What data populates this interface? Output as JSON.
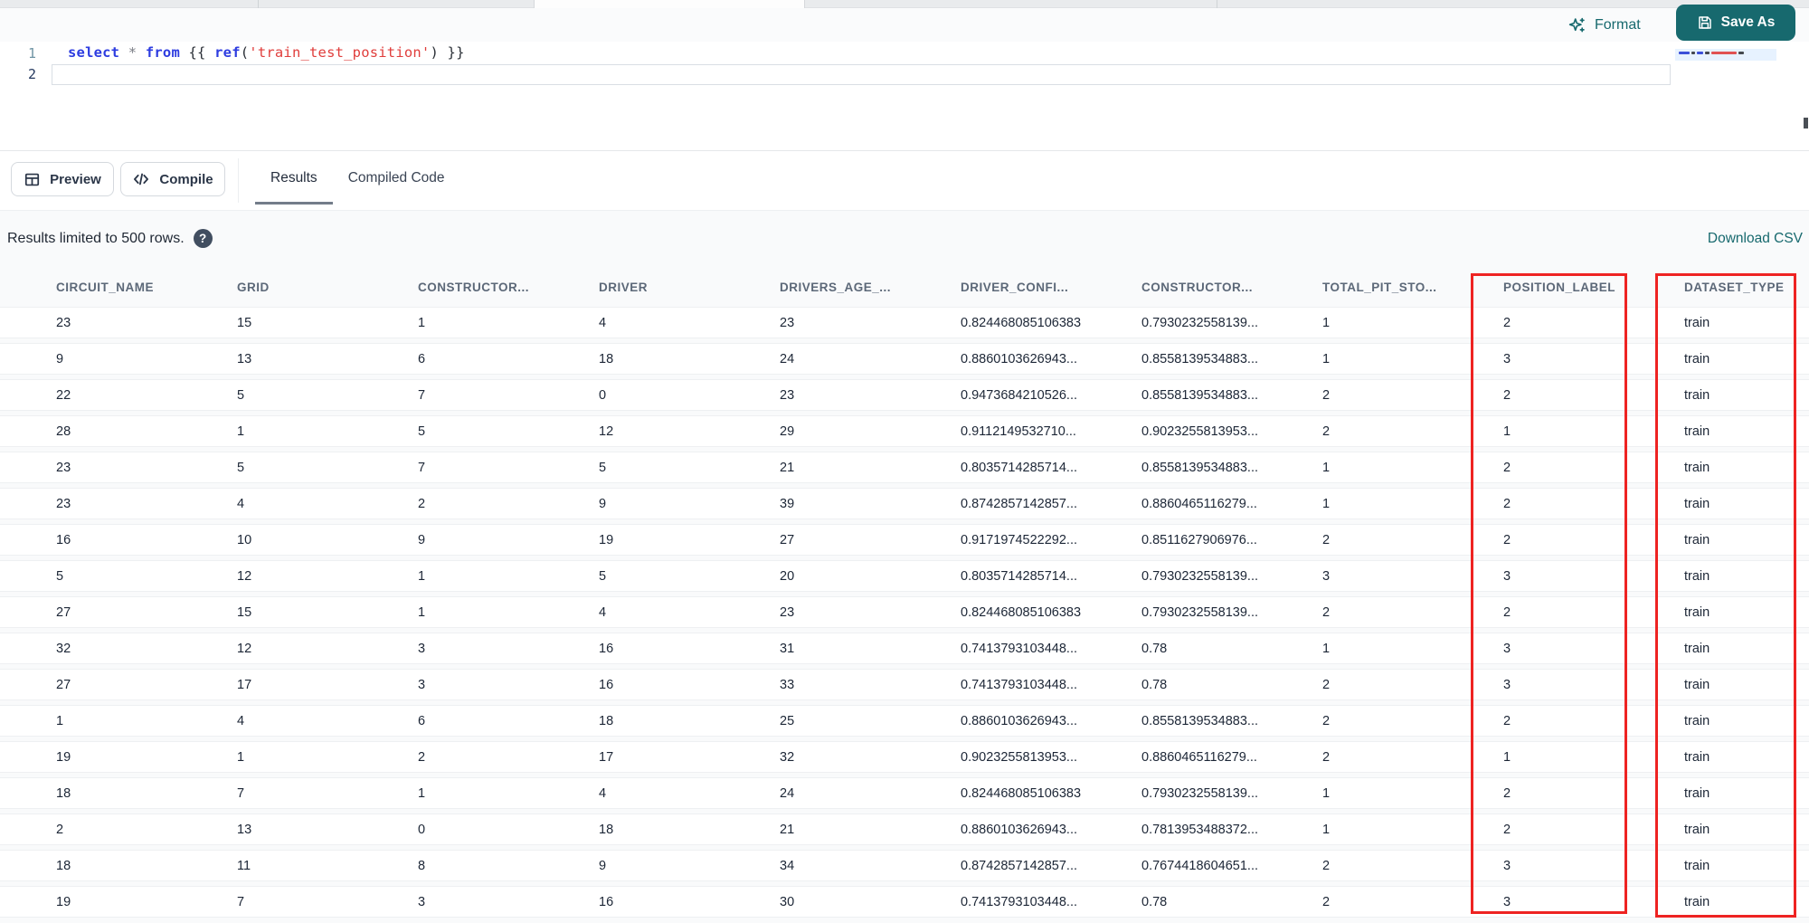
{
  "colors": {
    "accent_teal": "#17696e",
    "highlight_red": "#ee2322",
    "keyword_blue": "#2d3ce0",
    "string_red": "#e03e3c"
  },
  "top_bar": {
    "format_label": "Format",
    "save_as_label": "Save As"
  },
  "editor": {
    "line_numbers": [
      "1",
      "2"
    ],
    "code_plain": "select * from {{ ref('train_test_position') }}",
    "code_tokens": [
      {
        "t": "select",
        "c": "kw"
      },
      {
        "t": " ",
        "c": "pl"
      },
      {
        "t": "*",
        "c": "op"
      },
      {
        "t": " ",
        "c": "pl"
      },
      {
        "t": "from",
        "c": "kw"
      },
      {
        "t": " {{ ",
        "c": "pl"
      },
      {
        "t": "ref",
        "c": "kw"
      },
      {
        "t": "(",
        "c": "pl"
      },
      {
        "t": "'train_test_position'",
        "c": "str"
      },
      {
        "t": ")",
        "c": "pl"
      },
      {
        "t": " }}",
        "c": "pl"
      }
    ]
  },
  "action_bar": {
    "preview_label": "Preview",
    "compile_label": "Compile",
    "tabs": [
      {
        "label": "Results",
        "active": true
      },
      {
        "label": "Compiled Code",
        "active": false
      }
    ]
  },
  "results": {
    "limit_notice": "Results limited to 500 rows.",
    "help_icon": "?",
    "download_csv_label": "Download CSV",
    "columns": [
      "CIRCUIT_NAME",
      "GRID",
      "CONSTRUCTOR...",
      "DRIVER",
      "DRIVERS_AGE_...",
      "DRIVER_CONFI...",
      "CONSTRUCTOR...",
      "TOTAL_PIT_STO...",
      "POSITION_LABEL",
      "DATASET_TYPE"
    ],
    "rows": [
      [
        "23",
        "15",
        "1",
        "4",
        "23",
        "0.824468085106383",
        "0.7930232558139...",
        "1",
        "2",
        "train"
      ],
      [
        "9",
        "13",
        "6",
        "18",
        "24",
        "0.8860103626943...",
        "0.8558139534883...",
        "1",
        "3",
        "train"
      ],
      [
        "22",
        "5",
        "7",
        "0",
        "23",
        "0.9473684210526...",
        "0.8558139534883...",
        "2",
        "2",
        "train"
      ],
      [
        "28",
        "1",
        "5",
        "12",
        "29",
        "0.9112149532710...",
        "0.9023255813953...",
        "2",
        "1",
        "train"
      ],
      [
        "23",
        "5",
        "7",
        "5",
        "21",
        "0.8035714285714...",
        "0.8558139534883...",
        "1",
        "2",
        "train"
      ],
      [
        "23",
        "4",
        "2",
        "9",
        "39",
        "0.8742857142857...",
        "0.8860465116279...",
        "1",
        "2",
        "train"
      ],
      [
        "16",
        "10",
        "9",
        "19",
        "27",
        "0.9171974522292...",
        "0.8511627906976...",
        "2",
        "2",
        "train"
      ],
      [
        "5",
        "12",
        "1",
        "5",
        "20",
        "0.8035714285714...",
        "0.7930232558139...",
        "3",
        "3",
        "train"
      ],
      [
        "27",
        "15",
        "1",
        "4",
        "23",
        "0.824468085106383",
        "0.7930232558139...",
        "2",
        "2",
        "train"
      ],
      [
        "32",
        "12",
        "3",
        "16",
        "31",
        "0.7413793103448...",
        "0.78",
        "1",
        "3",
        "train"
      ],
      [
        "27",
        "17",
        "3",
        "16",
        "33",
        "0.7413793103448...",
        "0.78",
        "2",
        "3",
        "train"
      ],
      [
        "1",
        "4",
        "6",
        "18",
        "25",
        "0.8860103626943...",
        "0.8558139534883...",
        "2",
        "2",
        "train"
      ],
      [
        "19",
        "1",
        "2",
        "17",
        "32",
        "0.9023255813953...",
        "0.8860465116279...",
        "2",
        "1",
        "train"
      ],
      [
        "18",
        "7",
        "1",
        "4",
        "24",
        "0.824468085106383",
        "0.7930232558139...",
        "1",
        "2",
        "train"
      ],
      [
        "2",
        "13",
        "0",
        "18",
        "21",
        "0.8860103626943...",
        "0.7813953488372...",
        "1",
        "2",
        "train"
      ],
      [
        "18",
        "11",
        "8",
        "9",
        "34",
        "0.8742857142857...",
        "0.7674418604651...",
        "2",
        "3",
        "train"
      ],
      [
        "19",
        "7",
        "3",
        "16",
        "30",
        "0.7413793103448...",
        "0.78",
        "2",
        "3",
        "train"
      ]
    ],
    "highlighted_columns": [
      "POSITION_LABEL",
      "DATASET_TYPE"
    ]
  }
}
